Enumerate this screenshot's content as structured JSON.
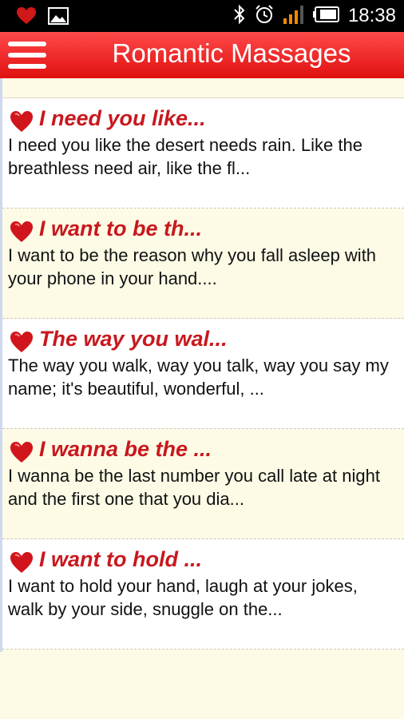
{
  "status": {
    "time": "18:38"
  },
  "appbar": {
    "title": "Romantic Massages"
  },
  "messages": [
    {
      "title": "I need you like...",
      "preview": "I need you like the desert needs rain. Like the breathless need air, like the fl..."
    },
    {
      "title": "I want to be th...",
      "preview": "I want to be the reason why you fall asleep with your phone in your hand...."
    },
    {
      "title": "The way you wal...",
      "preview": "The way you walk, way you talk, way you say my name; it's beautiful, wonderful, ..."
    },
    {
      "title": "I wanna be the ...",
      "preview": "I wanna be the last number you call late at night and the first one that you dia..."
    },
    {
      "title": "I want to hold ...",
      "preview": "I want to hold your hand, laugh at your jokes, walk by your side, snuggle on the..."
    }
  ],
  "colors": {
    "accent": "#e01010",
    "title_text": "#c8181e",
    "even_row": "#fdfbe6",
    "odd_row": "#ffffff"
  },
  "icons": [
    "notification-heart-icon",
    "gallery-icon",
    "bluetooth-icon",
    "alarm-icon",
    "signal-icon",
    "battery-icon",
    "menu-icon",
    "heart-icon"
  ]
}
